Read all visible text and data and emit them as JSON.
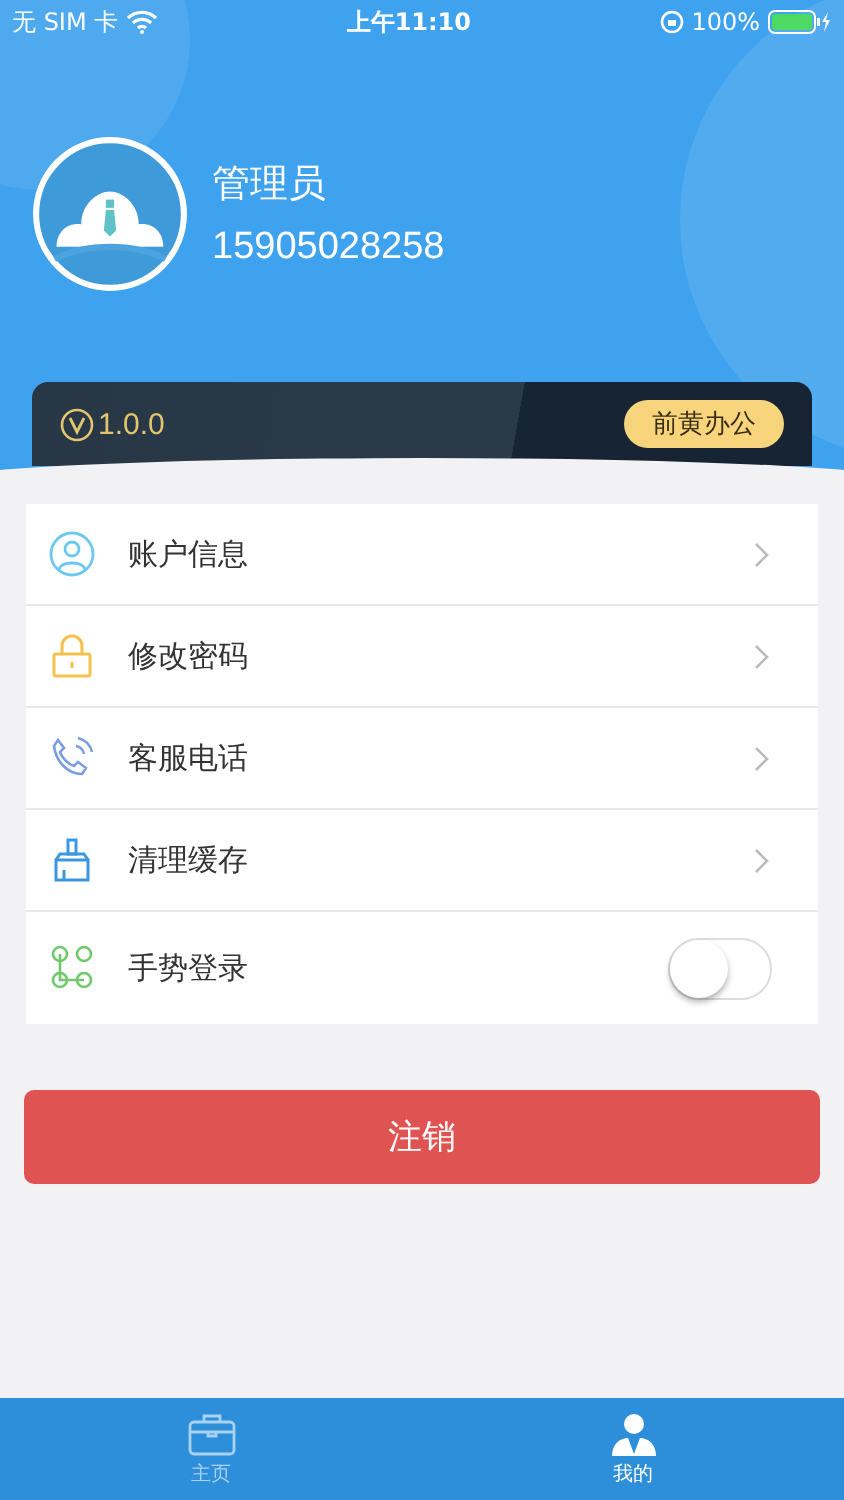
{
  "status_bar": {
    "carrier": "无 SIM 卡",
    "time": "上午11:10",
    "battery": "100%"
  },
  "profile": {
    "name": "管理员",
    "phone": "15905028258"
  },
  "version_card": {
    "version": "1.0.0",
    "badge": "前黄办公"
  },
  "menu": [
    {
      "kind": "link",
      "label": "账户信息"
    },
    {
      "kind": "link",
      "label": "修改密码"
    },
    {
      "kind": "link",
      "label": "客服电话"
    },
    {
      "kind": "link",
      "label": "清理缓存"
    },
    {
      "kind": "toggle",
      "label": "手势登录",
      "on": false
    }
  ],
  "logout_button": "注销",
  "tabs": [
    {
      "label": "主页",
      "selected": false
    },
    {
      "label": "我的",
      "selected": true
    }
  ]
}
